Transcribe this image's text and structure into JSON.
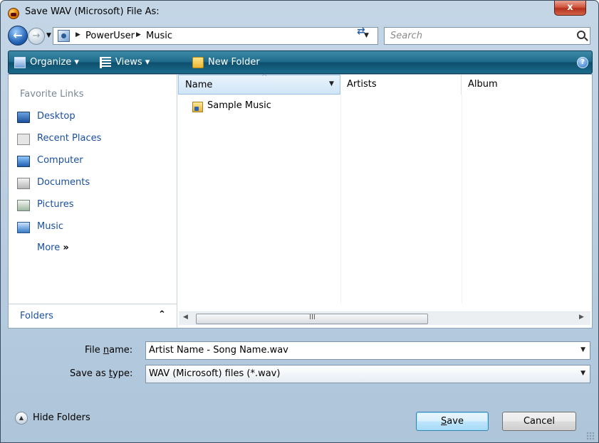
{
  "window": {
    "title": "Save WAV (Microsoft) File As:",
    "close_label": "x"
  },
  "address": {
    "breadcrumbs": [
      "PowerUser",
      "Music"
    ],
    "search_placeholder": "Search"
  },
  "toolbar": {
    "organize_label": "Organize",
    "views_label": "Views",
    "new_folder_label": "New Folder",
    "help_label": "?"
  },
  "nav": {
    "favorite_links_title": "Favorite Links",
    "items": [
      {
        "label": "Desktop",
        "icon": "desktop-icon"
      },
      {
        "label": "Recent Places",
        "icon": "recent-places-icon"
      },
      {
        "label": "Computer",
        "icon": "computer-icon"
      },
      {
        "label": "Documents",
        "icon": "documents-icon"
      },
      {
        "label": "Pictures",
        "icon": "pictures-icon"
      },
      {
        "label": "Music",
        "icon": "music-icon"
      }
    ],
    "more_label": "More",
    "more_glyph": "»",
    "folders_label": "Folders"
  },
  "files": {
    "columns": [
      "Name",
      "Artists",
      "Album"
    ],
    "rows": [
      {
        "name": "Sample Music",
        "icon": "shortcut-folder-icon"
      }
    ]
  },
  "form": {
    "file_name_label_pre": "File ",
    "file_name_label_ul": "n",
    "file_name_label_post": "ame:",
    "file_name_value": "Artist Name - Song Name.wav",
    "save_type_label_pre": "Save as ",
    "save_type_label_ul": "t",
    "save_type_label_post": "ype:",
    "save_type_value": "WAV (Microsoft) files (*.wav)"
  },
  "footer": {
    "hide_folders_label": "Hide Folders",
    "save_label_ul": "S",
    "save_label_post": "ave",
    "cancel_label": "Cancel"
  }
}
